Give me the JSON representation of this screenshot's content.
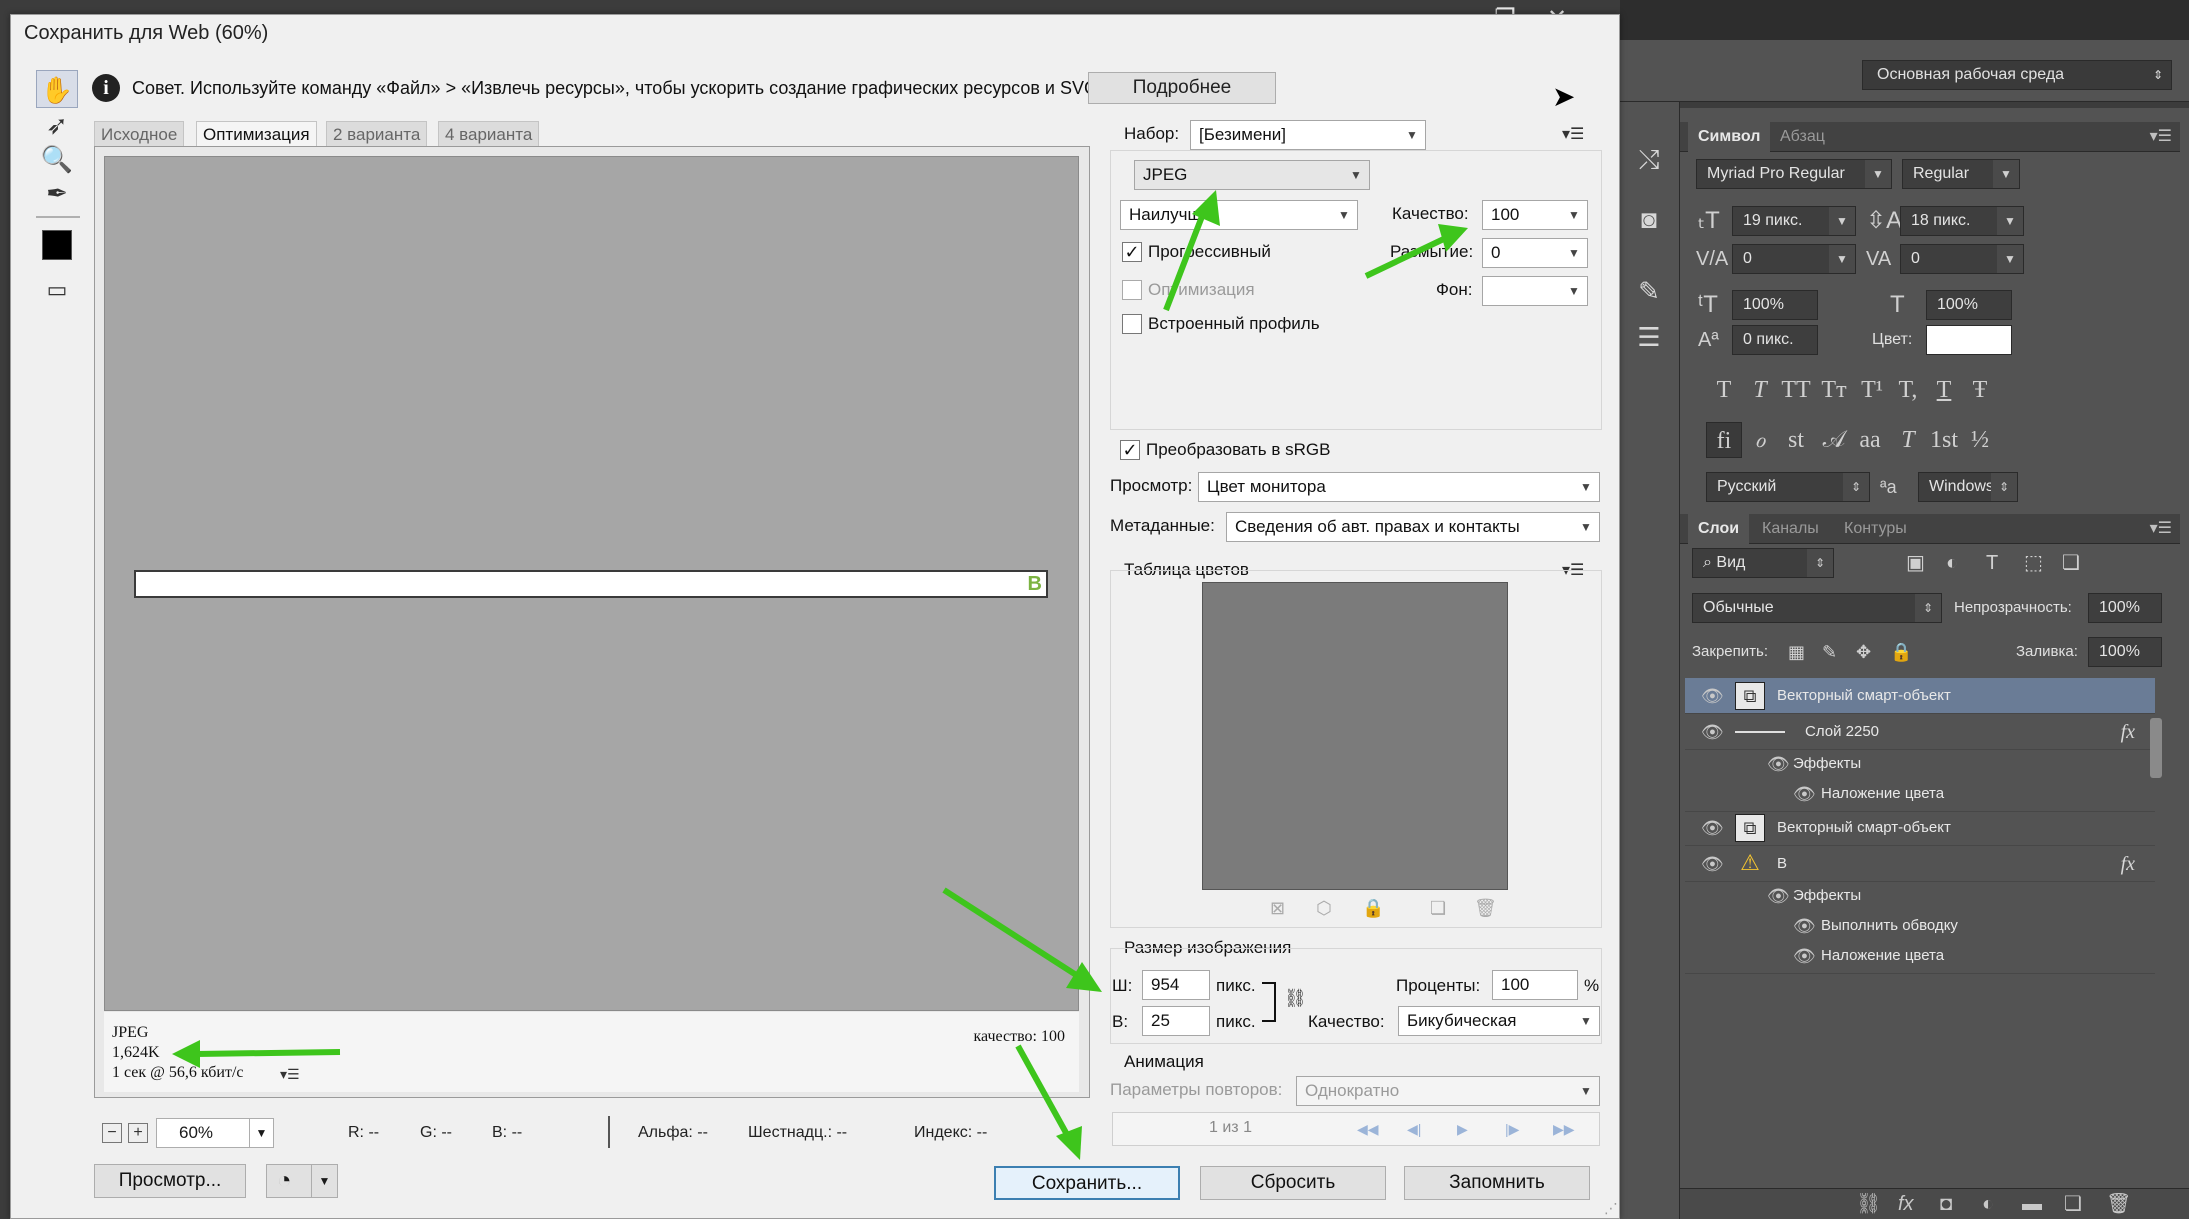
{
  "app": {
    "window_controls": {
      "minimize": "—",
      "restore": "❐",
      "close": "✕"
    },
    "workspace": "Основная рабочая среда"
  },
  "character_panel": {
    "tabs": [
      "Символ",
      "Абзац"
    ],
    "font_family": "Myriad Pro Regular",
    "font_style": "Regular",
    "font_size": "19 пикс.",
    "leading": "18 пикс.",
    "kerning": "0",
    "tracking": "0",
    "vertical_scale": "100%",
    "horizontal_scale": "100%",
    "baseline_shift": "0 пикс.",
    "color_label": "Цвет:",
    "color": "#ffffff",
    "style_buttons": [
      "T",
      "T",
      "TT",
      "Tт",
      "T¹",
      "T,",
      "T",
      "Ŧ"
    ],
    "opentype_buttons": [
      "fi",
      "ℴ",
      "st",
      "𝒜",
      "aa",
      "T",
      "1st",
      "½"
    ],
    "language": "Русский",
    "antialias_icon": "ªa",
    "antialias": "Windows"
  },
  "layers_panel": {
    "tabs": [
      "Слои",
      "Каналы",
      "Контуры"
    ],
    "filter": "Вид",
    "blend_mode": "Обычные",
    "opacity_label": "Непрозрачность:",
    "opacity": "100%",
    "lock_label": "Закрепить:",
    "fill_label": "Заливка:",
    "fill": "100%",
    "layers": [
      {
        "name": "Векторный смарт-объект",
        "selected": true
      },
      {
        "name": "Слой 2250",
        "fx": "fx"
      },
      {
        "name": "Эффекты"
      },
      {
        "name": "Наложение цвета"
      },
      {
        "name": "Векторный смарт-объект"
      },
      {
        "name": "B",
        "fx": "fx"
      },
      {
        "name": "Эффекты"
      },
      {
        "name": "Выполнить обводку"
      },
      {
        "name": "Наложение цвета"
      }
    ]
  },
  "dialog": {
    "title": "Сохранить для Web (60%)",
    "tip": "Совет. Используйте команду «Файл» > «Извлечь ресурсы», чтобы ускорить создание графических ресурсов и SVG.",
    "more_button": "Подробнее",
    "view_tabs": [
      "Исходное",
      "Оптимизация",
      "2 варианта",
      "4 варианта"
    ],
    "active_view_tab": "Оптимизация",
    "preview": {
      "strip_letter": "B",
      "format": "JPEG",
      "size": "1,624K",
      "time": "1 сек @ 56,6 кбит/с",
      "quality_note": "качество: 100"
    },
    "zoom": "60%",
    "readouts": {
      "r": "R: --",
      "g": "G: --",
      "b": "B: --",
      "alpha": "Альфа: --",
      "hex": "Шестнадц.: --",
      "index": "Индекс: --"
    },
    "preview_button": "Просмотр...",
    "save_button": "Сохранить...",
    "reset_button": "Сбросить",
    "remember_button": "Запомнить",
    "settings": {
      "preset_label": "Набор:",
      "preset": "[Безимени]",
      "format": "JPEG",
      "quality_preset": "Наилучш",
      "quality_label": "Качество:",
      "quality": "100",
      "progressive": "Прогрессивный",
      "progressive_checked": true,
      "blur_label": "Размытие:",
      "blur": "0",
      "optimized": "Оптимизация",
      "optimized_checked": false,
      "matte_label": "Фон:",
      "embed_profile": "Встроенный профиль",
      "embed_profile_checked": false,
      "convert_srgb": "Преобразовать в sRGB",
      "convert_srgb_checked": true,
      "preview_label": "Просмотр:",
      "preview_mode": "Цвет монитора",
      "metadata_label": "Метаданные:",
      "metadata": "Сведения об авт. правах и контакты",
      "color_table_title": "Таблица цветов",
      "image_size_title": "Размер изображения",
      "width_label": "Ш:",
      "width": "954",
      "height_label": "В:",
      "height": "25",
      "px_unit": "пикс.",
      "percent_label": "Проценты:",
      "percent": "100",
      "percent_unit": "%",
      "resample_label": "Качество:",
      "resample": "Бикубическая",
      "animation_title": "Анимация",
      "looping_label": "Параметры повторов:",
      "looping": "Однократно",
      "frames": "1 из 1"
    }
  }
}
